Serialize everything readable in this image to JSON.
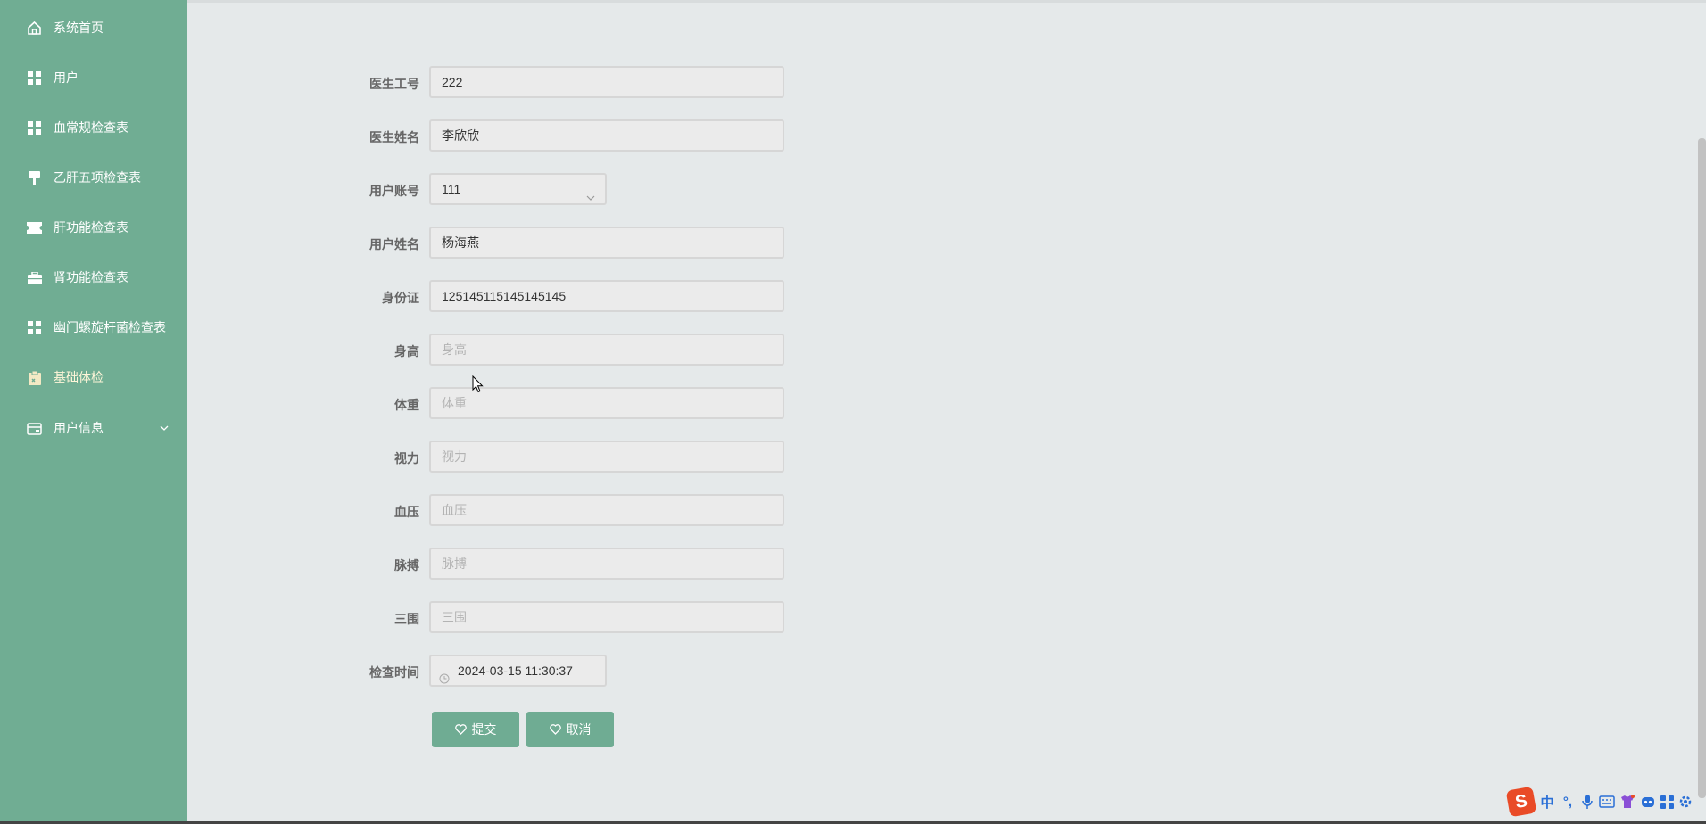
{
  "sidebar": {
    "items": [
      {
        "label": "系统首页",
        "icon": "home-icon"
      },
      {
        "label": "用户",
        "icon": "grid-icon"
      },
      {
        "label": "血常规检查表",
        "icon": "grid-icon"
      },
      {
        "label": "乙肝五项检查表",
        "icon": "brush-icon"
      },
      {
        "label": "肝功能检查表",
        "icon": "ticket-icon"
      },
      {
        "label": "肾功能检查表",
        "icon": "briefcase-icon"
      },
      {
        "label": "幽门螺旋杆菌检查表",
        "icon": "grid-icon"
      },
      {
        "label": "基础体检",
        "icon": "clipboard-icon",
        "active": true
      },
      {
        "label": "用户信息",
        "icon": "wallet-icon",
        "expandable": true
      }
    ]
  },
  "form": {
    "doctor_id": {
      "label": "医生工号",
      "value": "222"
    },
    "doctor_name": {
      "label": "医生姓名",
      "value": "李欣欣"
    },
    "user_account": {
      "label": "用户账号",
      "value": "111"
    },
    "user_name": {
      "label": "用户姓名",
      "value": "杨海燕"
    },
    "id_card": {
      "label": "身份证",
      "value": "125145115145145145"
    },
    "height": {
      "label": "身高",
      "placeholder": "身高"
    },
    "weight": {
      "label": "体重",
      "placeholder": "体重"
    },
    "vision": {
      "label": "视力",
      "placeholder": "视力"
    },
    "blood_pressure": {
      "label": "血压",
      "placeholder": "血压"
    },
    "pulse": {
      "label": "脉搏",
      "placeholder": "脉搏"
    },
    "measurements": {
      "label": "三围",
      "placeholder": "三围"
    },
    "check_time": {
      "label": "检查时间",
      "value": "2024-03-15 11:30:37"
    },
    "submit_label": "提交",
    "cancel_label": "取消"
  },
  "tray": {
    "ime_logo": "S",
    "ime_mode": "中",
    "punct": "°,"
  },
  "colors": {
    "sidebar_bg": "#70ad93",
    "button_bg": "#6fac93",
    "page_bg": "#e5e9ea"
  }
}
